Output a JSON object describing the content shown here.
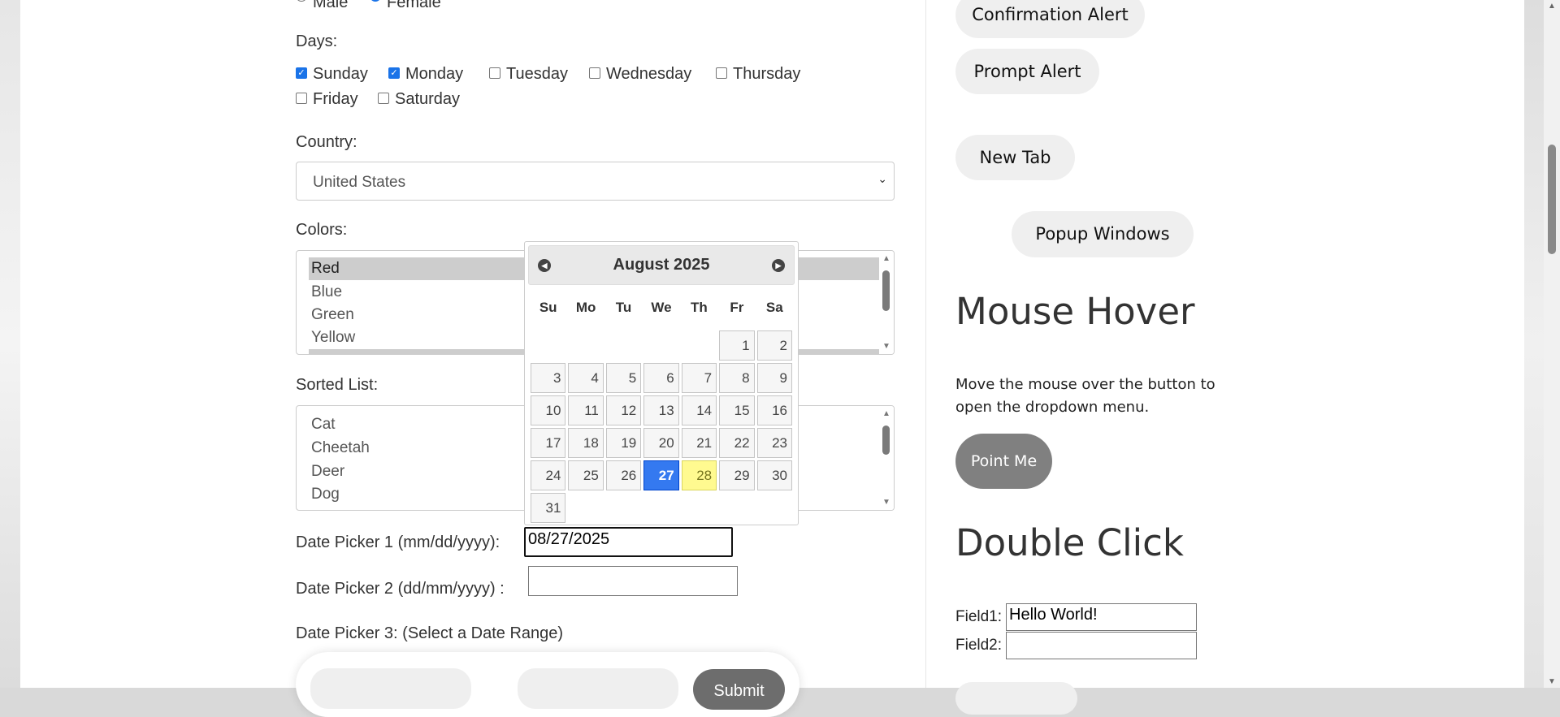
{
  "gender": {
    "options": [
      "Male",
      "Female"
    ],
    "selected": "Female"
  },
  "days": {
    "label": "Days:",
    "items": [
      {
        "label": "Sunday",
        "checked": true
      },
      {
        "label": "Monday",
        "checked": true
      },
      {
        "label": "Tuesday",
        "checked": false
      },
      {
        "label": "Wednesday",
        "checked": false
      },
      {
        "label": "Thursday",
        "checked": false
      },
      {
        "label": "Friday",
        "checked": false
      },
      {
        "label": "Saturday",
        "checked": false
      }
    ]
  },
  "country": {
    "label": "Country:",
    "value": "United States"
  },
  "colors": {
    "label": "Colors:",
    "options": [
      "Red",
      "Blue",
      "Green",
      "Yellow"
    ]
  },
  "sorted_list": {
    "label": "Sorted List:",
    "options": [
      "Cat",
      "Cheetah",
      "Deer",
      "Dog"
    ]
  },
  "calendar": {
    "title": "August 2025",
    "weekdays": [
      "Su",
      "Mo",
      "Tu",
      "We",
      "Th",
      "Fr",
      "Sa"
    ],
    "selected_day": 27,
    "today": 28,
    "days": 31,
    "first_weekday": 5
  },
  "datepicker1": {
    "label": "Date Picker 1 (mm/dd/yyyy):",
    "value": "08/27/2025"
  },
  "datepicker2": {
    "label": "Date Picker 2 (dd/mm/yyyy) :",
    "value": ""
  },
  "datepicker3": {
    "label": "Date Picker 3: (Select a Date Range)",
    "submit": "Submit"
  },
  "right": {
    "confirmation_alert": "Confirmation Alert",
    "prompt_alert": "Prompt Alert",
    "new_tab": "New Tab",
    "popup_windows": "Popup Windows",
    "mouse_hover_title": "Mouse Hover",
    "mouse_hover_desc_1": "Move the mouse over the button to",
    "mouse_hover_desc_2": "open the dropdown menu.",
    "point_me": "Point Me",
    "double_click_title": "Double Click",
    "field1_label": "Field1:",
    "field1_value": "Hello World!",
    "field2_label": "Field2:",
    "field2_value": ""
  }
}
